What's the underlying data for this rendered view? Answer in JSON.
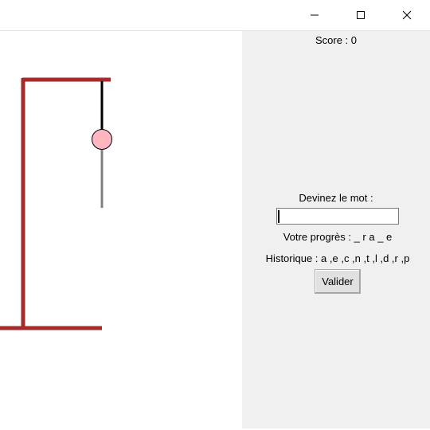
{
  "window": {
    "controls": {
      "minimize_icon": "minimize-icon",
      "maximize_icon": "maximize-icon",
      "close_icon": "close-icon"
    }
  },
  "game": {
    "score_text": "Score : 0",
    "guess_label": "Devinez le mot :",
    "guess_input_value": "",
    "progress_text": "Votre progrès : _ r a _ e",
    "history_text": "Historique : a ,e ,c ,n ,t ,l ,d ,r ,p",
    "validate_label": "Valider"
  },
  "colors": {
    "gallows": "#a52a2a",
    "rope": "#000000",
    "head_fill": "#ffb6c1",
    "body": "#808080",
    "panel_bg": "#f0f0f0"
  }
}
